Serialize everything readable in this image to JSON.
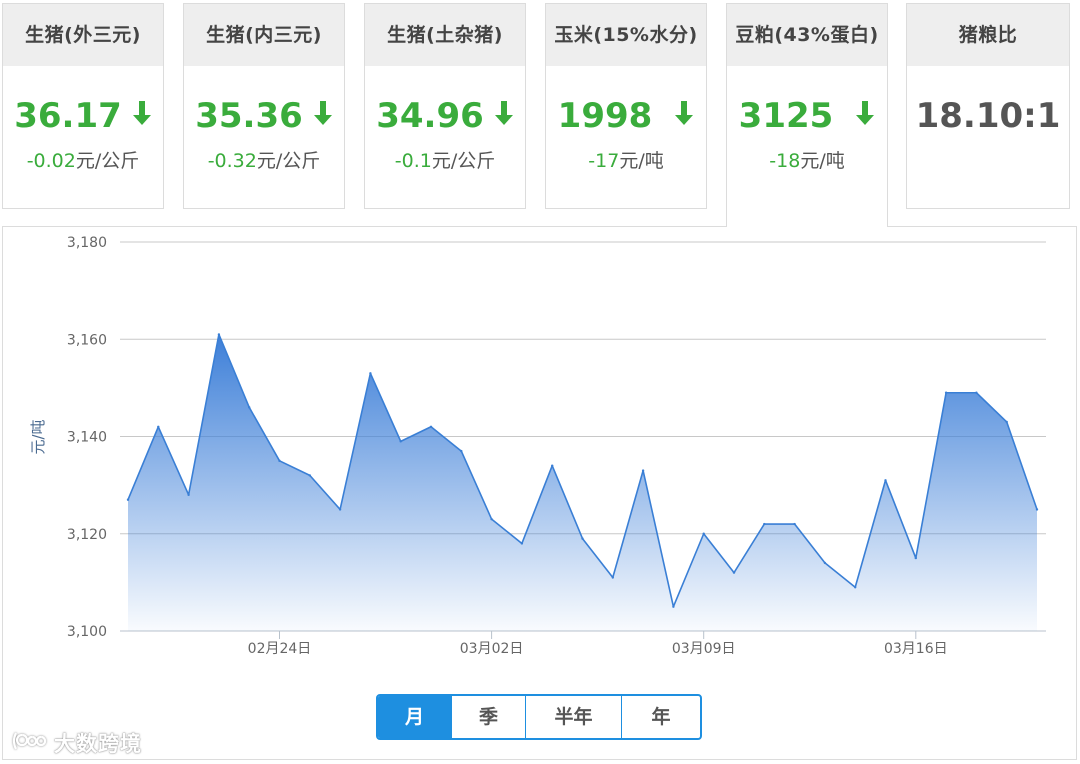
{
  "cards": [
    {
      "title": "生猪(外三元)",
      "price": "36.17",
      "delta": "-0.02",
      "unit": "元/公斤",
      "trend": "down"
    },
    {
      "title": "生猪(内三元)",
      "price": "35.36",
      "delta": "-0.32",
      "unit": "元/公斤",
      "trend": "down"
    },
    {
      "title": "生猪(土杂猪)",
      "price": "34.96",
      "delta": "-0.1",
      "unit": "元/公斤",
      "trend": "down"
    },
    {
      "title": "玉米(15%水分)",
      "price": "1998",
      "delta": "-17",
      "unit": "元/吨",
      "trend": "down"
    },
    {
      "title": "豆粕(43%蛋白)",
      "price": "3125",
      "delta": "-18",
      "unit": "元/吨",
      "trend": "down",
      "active": true
    },
    {
      "title": "猪粮比",
      "price": "18.10:1",
      "delta": "",
      "unit": "",
      "trend": "none"
    }
  ],
  "colors": {
    "green": "#3aac3c",
    "accent": "#1e8fe0",
    "line": "#3a7fd5"
  },
  "chart_data": {
    "type": "area",
    "title": "",
    "xlabel": "",
    "ylabel": "元/吨",
    "ylim": [
      3100,
      3180
    ],
    "yticks": [
      3100,
      3120,
      3140,
      3160,
      3180
    ],
    "y_tick_labels": [
      "3,100",
      "3,120",
      "3,140",
      "3,160",
      "3,180"
    ],
    "xticks": [
      {
        "index": 5,
        "label": "02月24日"
      },
      {
        "index": 12,
        "label": "03月02日"
      },
      {
        "index": 19,
        "label": "03月09日"
      },
      {
        "index": 26,
        "label": "03月16日"
      }
    ],
    "grid": true,
    "legend": "none",
    "series": [
      {
        "values": [
          3127,
          3142,
          3128,
          3161,
          3146,
          3135,
          3132,
          3125,
          3153,
          3139,
          3142,
          3137,
          3123,
          3118,
          3134,
          3119,
          3111,
          3133,
          3105,
          3120,
          3112,
          3122,
          3122,
          3114,
          3109,
          3131,
          3115,
          3149,
          3149,
          3143,
          3125
        ]
      }
    ]
  },
  "periods": {
    "month": "月",
    "quarter": "季",
    "half_year": "半年",
    "year": "年",
    "active": "month"
  },
  "watermark": "大数跨境"
}
